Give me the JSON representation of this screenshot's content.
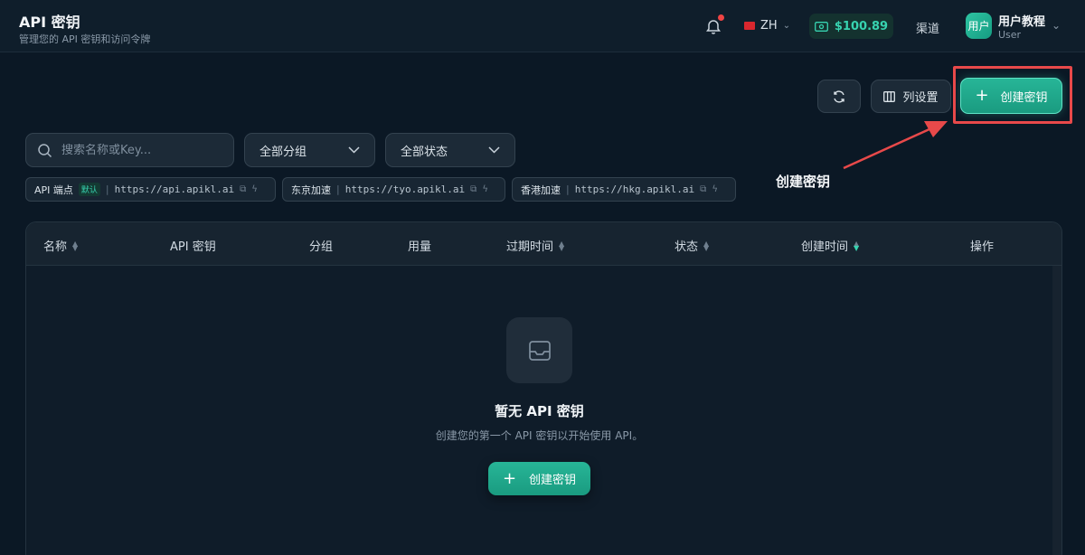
{
  "header": {
    "title": "API 密钥",
    "subtitle": "管理您的 API 密钥和访问令牌",
    "language": "ZH",
    "balance": "$100.89",
    "channel_label": "渠道",
    "avatar_text": "用户",
    "user_name": "用户教程",
    "user_role": "User"
  },
  "toolbar": {
    "columns_label": "列设置",
    "create_label": "创建密钥"
  },
  "annotation": {
    "label": "创建密钥"
  },
  "filters": {
    "search_placeholder": "搜索名称或Key...",
    "group_select": "全部分组",
    "status_select": "全部状态"
  },
  "endpoints": [
    {
      "name": "API 端点",
      "badge": "默认",
      "url": "https://api.apikl.ai"
    },
    {
      "name": "东京加速",
      "url": "https://tyo.apikl.ai"
    },
    {
      "name": "香港加速",
      "url": "https://hkg.apikl.ai"
    }
  ],
  "table": {
    "columns": [
      "名称",
      "API 密钥",
      "分组",
      "用量",
      "过期时间",
      "状态",
      "创建时间",
      "操作"
    ],
    "empty_title": "暂无 API 密钥",
    "empty_desc": "创建您的第一个 API 密钥以开始使用 API。",
    "empty_button": "创建密钥"
  },
  "colors": {
    "accent": "#2ec4a2",
    "annotation": "#e8494a",
    "background": "#0b1825"
  }
}
